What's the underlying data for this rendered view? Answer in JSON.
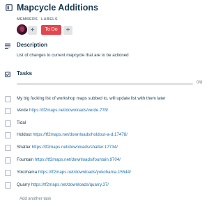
{
  "card": {
    "title": "Mapcycle Additions",
    "icon": "card-icon"
  },
  "members": {
    "label": "MEMBERS",
    "add_label": "+"
  },
  "labels": {
    "label": "LABELS",
    "chip_text": "To Do",
    "chip_color": "#e5454c",
    "add_label": "+"
  },
  "description": {
    "heading": "Description",
    "text": "List of changes to current mapcycle that are to be actioned"
  },
  "tasks": {
    "heading": "Tasks",
    "progress_text": "0/8",
    "progress_fraction": 0,
    "items": [
      {
        "name": "My big fucking list of workshop maps subbed to, will update list with them later",
        "link": ""
      },
      {
        "name": "Verde",
        "link": "https://tf2maps.net/downloads/verde.778/"
      },
      {
        "name": "Tidal",
        "link": ""
      },
      {
        "name": "Holdout",
        "link": "https://tf2maps.net/downloads/holdout-a-d.17478/"
      },
      {
        "name": "Shatter",
        "link": "https://tf2maps.net/downloads/shatter.17734/"
      },
      {
        "name": "Fountain",
        "link": "https://tf2maps.net/downloads/fountain.9704/"
      },
      {
        "name": "Yokohama",
        "link": "https://tf2maps.net/downloads/yokohama.15544/"
      },
      {
        "name": "Quarry",
        "link": "https://tf2maps.net/downloads/quarry.37/"
      }
    ],
    "add_task_label": "Add another task"
  }
}
